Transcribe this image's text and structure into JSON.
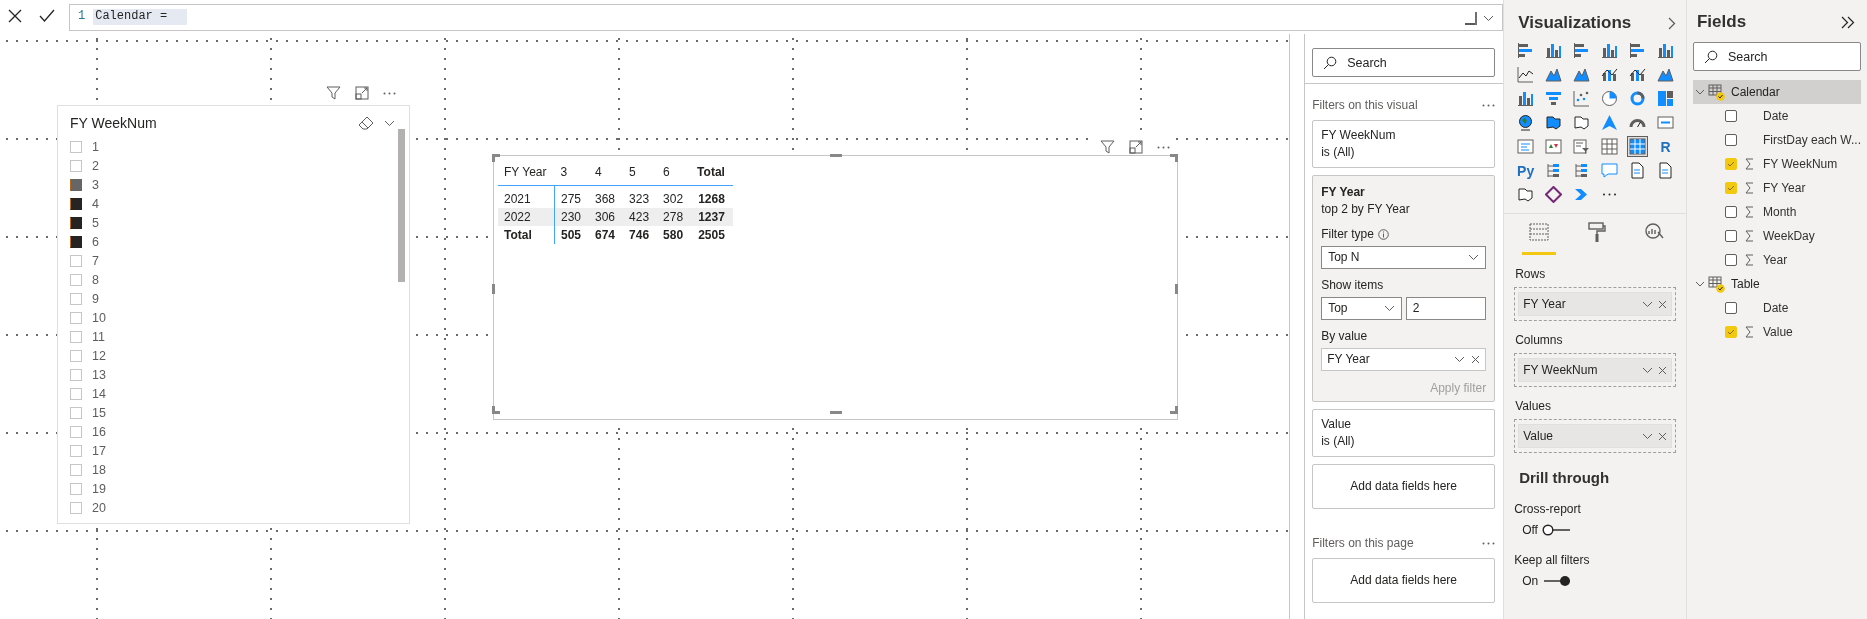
{
  "formula_bar": {
    "line_number": "1",
    "code": "Calendar ="
  },
  "slicer": {
    "title": "FY WeekNum",
    "items": [
      {
        "label": "1",
        "checked": false,
        "hovered": false
      },
      {
        "label": "2",
        "checked": false,
        "hovered": false
      },
      {
        "label": "3",
        "checked": false,
        "hovered": true
      },
      {
        "label": "4",
        "checked": true,
        "hovered": false
      },
      {
        "label": "5",
        "checked": true,
        "hovered": false
      },
      {
        "label": "6",
        "checked": true,
        "hovered": false
      },
      {
        "label": "7",
        "checked": false,
        "hovered": false
      },
      {
        "label": "8",
        "checked": false,
        "hovered": false
      },
      {
        "label": "9",
        "checked": false,
        "hovered": false
      },
      {
        "label": "10",
        "checked": false,
        "hovered": false
      },
      {
        "label": "11",
        "checked": false,
        "hovered": false
      },
      {
        "label": "12",
        "checked": false,
        "hovered": false
      },
      {
        "label": "13",
        "checked": false,
        "hovered": false
      },
      {
        "label": "14",
        "checked": false,
        "hovered": false
      },
      {
        "label": "15",
        "checked": false,
        "hovered": false
      },
      {
        "label": "16",
        "checked": false,
        "hovered": false
      },
      {
        "label": "17",
        "checked": false,
        "hovered": false
      },
      {
        "label": "18",
        "checked": false,
        "hovered": false
      },
      {
        "label": "19",
        "checked": false,
        "hovered": false
      },
      {
        "label": "20",
        "checked": false,
        "hovered": false
      }
    ]
  },
  "matrix": {
    "columns": [
      "FY Year",
      "3",
      "4",
      "5",
      "6",
      "Total"
    ],
    "rows": [
      {
        "kind": "data",
        "cells": [
          "2021",
          "275",
          "368",
          "323",
          "302",
          "1268"
        ]
      },
      {
        "kind": "data",
        "cells": [
          "2022",
          "230",
          "306",
          "423",
          "278",
          "1237"
        ]
      },
      {
        "kind": "total",
        "cells": [
          "Total",
          "505",
          "674",
          "746",
          "580",
          "2505"
        ]
      }
    ]
  },
  "filters": {
    "search_placeholder": "Search",
    "visual_heading": "Filters on this visual",
    "visual_cards": [
      {
        "kind": "summary",
        "field": "FY WeekNum",
        "summary": "is (All)"
      },
      {
        "kind": "expanded",
        "field": "FY Year",
        "summary": "top 2 by FY Year",
        "filter_type_label": "Filter type",
        "filter_type": "Top N",
        "show_items_label": "Show items",
        "show_direction": "Top",
        "show_count": "2",
        "by_value_label": "By value",
        "by_value": "FY Year",
        "apply": "Apply filter",
        "apply_disabled": true
      },
      {
        "kind": "summary",
        "field": "Value",
        "summary": "is (All)"
      },
      {
        "kind": "drop",
        "text": "Add data fields here"
      }
    ],
    "page_heading": "Filters on this page",
    "page_cards": [
      {
        "kind": "drop",
        "text": "Add data fields here"
      }
    ]
  },
  "visualizations": {
    "title": "Visualizations",
    "visual_types": [
      {
        "kind": "stacked-bar",
        "selected": false
      },
      {
        "kind": "stacked-column",
        "selected": false
      },
      {
        "kind": "clustered-bar",
        "selected": false
      },
      {
        "kind": "clustered-column",
        "selected": false
      },
      {
        "kind": "bar-100",
        "selected": false
      },
      {
        "kind": "column-100",
        "selected": false
      },
      {
        "kind": "line",
        "selected": false
      },
      {
        "kind": "area",
        "selected": false
      },
      {
        "kind": "stacked-area",
        "selected": false
      },
      {
        "kind": "line-column",
        "selected": false
      },
      {
        "kind": "line-column-2",
        "selected": false
      },
      {
        "kind": "ribbon",
        "selected": false
      },
      {
        "kind": "waterfall",
        "selected": false
      },
      {
        "kind": "funnel",
        "selected": false
      },
      {
        "kind": "scatter",
        "selected": false
      },
      {
        "kind": "pie",
        "selected": false
      },
      {
        "kind": "donut",
        "selected": false
      },
      {
        "kind": "treemap",
        "selected": false
      },
      {
        "kind": "map",
        "selected": false
      },
      {
        "kind": "filled-map",
        "selected": false
      },
      {
        "kind": "shape-map",
        "selected": false
      },
      {
        "kind": "azure-map",
        "selected": false
      },
      {
        "kind": "gauge",
        "selected": false
      },
      {
        "kind": "card",
        "selected": false
      },
      {
        "kind": "multi-card",
        "selected": false
      },
      {
        "kind": "kpi",
        "selected": false
      },
      {
        "kind": "slicer",
        "selected": false
      },
      {
        "kind": "table",
        "selected": false
      },
      {
        "kind": "matrix",
        "selected": true
      },
      {
        "kind": "letter",
        "label": "R",
        "selected": false
      },
      {
        "kind": "letter",
        "label": "Py",
        "selected": false
      },
      {
        "kind": "key-influencers",
        "selected": false
      },
      {
        "kind": "decomposition",
        "selected": false
      },
      {
        "kind": "qa",
        "selected": false
      },
      {
        "kind": "smart-narrative",
        "selected": false
      },
      {
        "kind": "paginated",
        "selected": false
      },
      {
        "kind": "arcgis",
        "selected": false
      },
      {
        "kind": "power-apps",
        "selected": false
      },
      {
        "kind": "power-automate",
        "selected": false
      },
      {
        "kind": "more",
        "selected": false
      }
    ],
    "tabs": [
      {
        "kind": "fields",
        "selected": true
      },
      {
        "kind": "format",
        "selected": false
      },
      {
        "kind": "analytics",
        "selected": false
      }
    ],
    "wells": [
      {
        "label": "Rows",
        "field": "FY Year"
      },
      {
        "label": "Columns",
        "field": "FY WeekNum"
      },
      {
        "label": "Values",
        "field": "Value"
      }
    ],
    "drill_heading": "Drill through",
    "toggles": [
      {
        "label": "Cross-report",
        "state": "Off",
        "on": false
      },
      {
        "label": "Keep all filters",
        "state": "On",
        "on": true
      }
    ]
  },
  "fields": {
    "title": "Fields",
    "search_placeholder": "Search",
    "tables": [
      {
        "name": "Calendar",
        "expanded": true,
        "selected": true,
        "in_use": true,
        "children": [
          {
            "name": "Date",
            "kind": "plain",
            "checked": false
          },
          {
            "name": "FirstDay each W...",
            "kind": "plain",
            "checked": false
          },
          {
            "name": "FY WeekNum",
            "kind": "sum",
            "checked": true
          },
          {
            "name": "FY Year",
            "kind": "sum",
            "checked": true
          },
          {
            "name": "Month",
            "kind": "sum",
            "checked": false
          },
          {
            "name": "WeekDay",
            "kind": "sum",
            "checked": false
          },
          {
            "name": "Year",
            "kind": "sum",
            "checked": false
          }
        ]
      },
      {
        "name": "Table",
        "expanded": true,
        "selected": false,
        "in_use": true,
        "children": [
          {
            "name": "Date",
            "kind": "plain",
            "checked": false
          },
          {
            "name": "Value",
            "kind": "sum",
            "checked": true
          }
        ]
      }
    ]
  }
}
